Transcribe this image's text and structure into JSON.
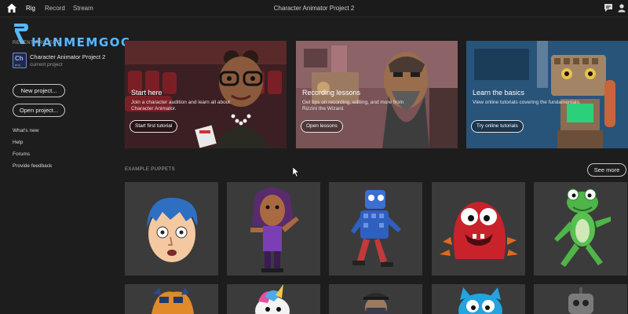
{
  "watermark": {
    "text": "HANMEMGOC",
    "color": "#59b7ff"
  },
  "topbar": {
    "nav": [
      "Rig",
      "Record",
      "Stream"
    ],
    "title": "Character Animator Project 2",
    "icons": [
      "home-icon",
      "chat-icon",
      "user-icon"
    ]
  },
  "sidebar": {
    "recent_header": "RECENT PROJECT",
    "project": {
      "icon_text": "Ch",
      "icon_ext": "proj",
      "name": "Character Animator Project 2",
      "subtitle": "current project"
    },
    "new_project": "New project...",
    "open_project": "Open project...",
    "links": [
      "What's new",
      "Help",
      "Forums",
      "Provide feedback"
    ]
  },
  "cards": [
    {
      "title": "Start here",
      "description": "Join a character audition and learn all about Character Animator.",
      "button": "Start first tutorial"
    },
    {
      "title": "Recording lessons",
      "description": "Get tips on recording, editing, and more from Rizzini the Wizard.",
      "button": "Open lessons"
    },
    {
      "title": "Learn the basics",
      "description": "View online tutorials covering the fundamentals.",
      "button": "Try online tutorials"
    }
  ],
  "puppets": {
    "section_label": "EXAMPLE PUPPETS",
    "see_more": "See more"
  },
  "colors": {
    "background": "#1d1d1d",
    "tile": "#3b3b3b",
    "accent": "#59b7ff"
  }
}
